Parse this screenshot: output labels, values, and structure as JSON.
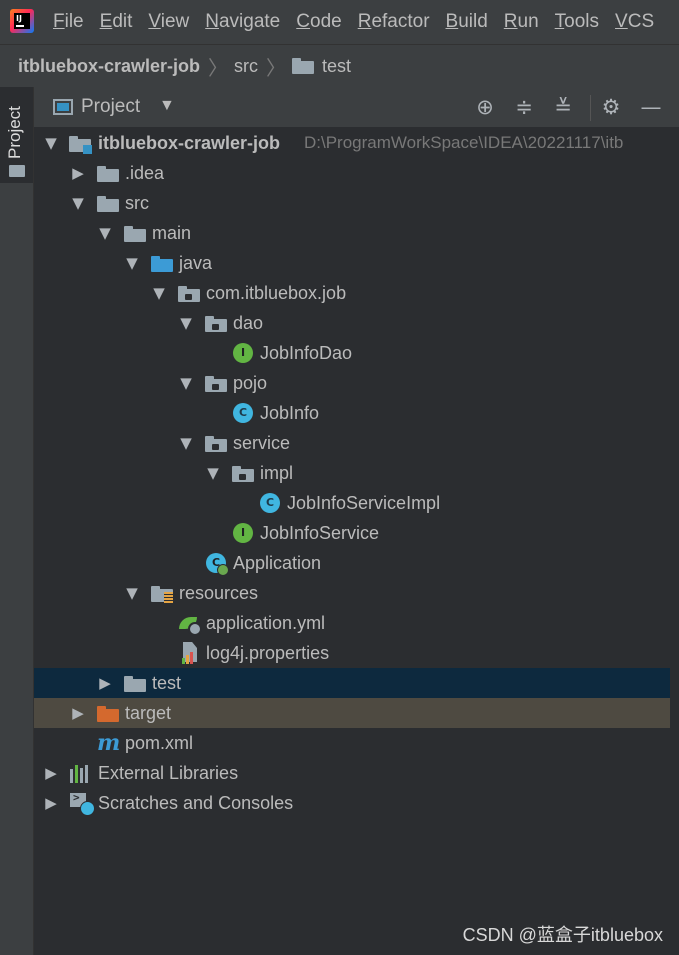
{
  "menubar": {
    "items": [
      "File",
      "Edit",
      "View",
      "Navigate",
      "Code",
      "Refactor",
      "Build",
      "Run",
      "Tools",
      "VCS"
    ]
  },
  "breadcrumb": {
    "project": "itbluebox-crawler-job",
    "parts": [
      "src",
      "test"
    ]
  },
  "tool_strip": {
    "tab_label": "Project"
  },
  "panel": {
    "title": "Project",
    "buttons": [
      "locate-icon",
      "expand-all-icon",
      "collapse-all-icon",
      "gear-icon",
      "minimize-icon"
    ]
  },
  "tree": {
    "root_label": "itbluebox-crawler-job",
    "root_path": "D:\\ProgramWorkSpace\\IDEA\\20221117\\itb",
    "items": [
      {
        "label": "itbluebox-crawler-job",
        "icon": "module-folder-icon",
        "expanded": true
      },
      {
        "label": ".idea",
        "icon": "folder-icon",
        "expanded": false
      },
      {
        "label": "src",
        "icon": "folder-icon",
        "expanded": true
      },
      {
        "label": "main",
        "icon": "folder-icon",
        "expanded": true
      },
      {
        "label": "java",
        "icon": "source-folder-icon",
        "expanded": true
      },
      {
        "label": "com.itbluebox.job",
        "icon": "package-icon",
        "expanded": true
      },
      {
        "label": "dao",
        "icon": "package-icon",
        "expanded": true
      },
      {
        "label": "JobInfoDao",
        "icon": "interface-icon"
      },
      {
        "label": "pojo",
        "icon": "package-icon",
        "expanded": true
      },
      {
        "label": "JobInfo",
        "icon": "class-icon"
      },
      {
        "label": "service",
        "icon": "package-icon",
        "expanded": true
      },
      {
        "label": "impl",
        "icon": "package-icon",
        "expanded": true
      },
      {
        "label": "JobInfoServiceImpl",
        "icon": "class-icon"
      },
      {
        "label": "JobInfoService",
        "icon": "interface-icon"
      },
      {
        "label": "Application",
        "icon": "spring-boot-class-icon"
      },
      {
        "label": "resources",
        "icon": "resources-folder-icon",
        "expanded": true
      },
      {
        "label": "application.yml",
        "icon": "spring-config-icon"
      },
      {
        "label": "log4j.properties",
        "icon": "properties-file-icon"
      },
      {
        "label": "test",
        "icon": "folder-icon",
        "expanded": false,
        "selected": true
      },
      {
        "label": "target",
        "icon": "excluded-folder-icon",
        "expanded": false
      },
      {
        "label": "pom.xml",
        "icon": "maven-icon"
      },
      {
        "label": "External Libraries",
        "icon": "libraries-icon",
        "expanded": false
      },
      {
        "label": "Scratches and Consoles",
        "icon": "scratches-icon",
        "expanded": false
      }
    ]
  },
  "interface_letter": "I",
  "class_letter": "C",
  "watermark": "CSDN @蓝盒子itbluebox",
  "colors": {
    "selected_row": "#0d293e",
    "excluded_row": "#4e4a41",
    "source_folder": "#3c9bd6",
    "excluded_folder": "#d4692e"
  }
}
